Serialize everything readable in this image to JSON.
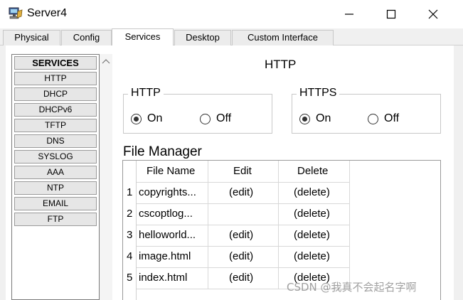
{
  "window": {
    "title": "Server4",
    "icon": "server-app-icon",
    "controls": [
      "minimize-icon",
      "maximize-icon",
      "close-icon"
    ]
  },
  "tabs": [
    {
      "label": "Physical",
      "active": false
    },
    {
      "label": "Config",
      "active": false
    },
    {
      "label": "Services",
      "active": true
    },
    {
      "label": "Desktop",
      "active": false
    },
    {
      "label": "Custom Interface",
      "active": false
    }
  ],
  "services": {
    "header": "SERVICES",
    "items": [
      "HTTP",
      "DHCP",
      "DHCPv6",
      "TFTP",
      "DNS",
      "SYSLOG",
      "AAA",
      "NTP",
      "EMAIL",
      "FTP"
    ]
  },
  "http_page": {
    "title": "HTTP",
    "http": {
      "label": "HTTP",
      "on_label": "On",
      "off_label": "Off",
      "selected": "On"
    },
    "https": {
      "label": "HTTPS",
      "on_label": "On",
      "off_label": "Off",
      "selected": "On"
    },
    "file_manager": {
      "title": "File Manager",
      "columns": [
        "File Name",
        "Edit",
        "Delete"
      ],
      "rows": [
        {
          "index": "1",
          "file": "copyrights...",
          "edit": "(edit)",
          "delete": "(delete)"
        },
        {
          "index": "2",
          "file": "cscoptlog...",
          "edit": "",
          "delete": "(delete)"
        },
        {
          "index": "3",
          "file": "helloworld...",
          "edit": "(edit)",
          "delete": "(delete)"
        },
        {
          "index": "4",
          "file": "image.html",
          "edit": "(edit)",
          "delete": "(delete)"
        },
        {
          "index": "5",
          "file": "index.html",
          "edit": "(edit)",
          "delete": "(delete)"
        }
      ]
    }
  },
  "watermark": "CSDN @我真不会起名字啊"
}
